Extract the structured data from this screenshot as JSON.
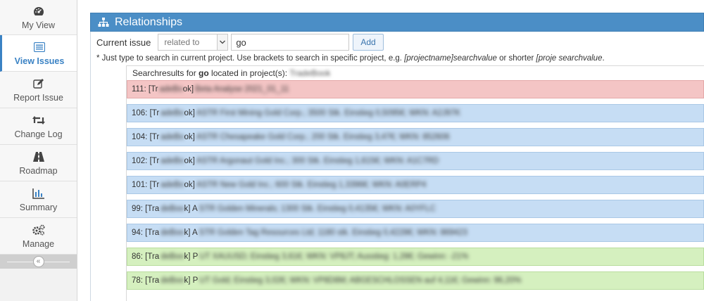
{
  "sidebar": {
    "items": [
      {
        "label": "My View",
        "icon": "dashboard-icon",
        "active": false
      },
      {
        "label": "View Issues",
        "icon": "list-icon",
        "active": true
      },
      {
        "label": "Report Issue",
        "icon": "edit-icon",
        "active": false
      },
      {
        "label": "Change Log",
        "icon": "retweet-icon",
        "active": false
      },
      {
        "label": "Roadmap",
        "icon": "road-icon",
        "active": false
      },
      {
        "label": "Summary",
        "icon": "bar-chart-icon",
        "active": false
      },
      {
        "label": "Manage",
        "icon": "gears-icon",
        "active": false
      }
    ],
    "collapse_glyph": "«"
  },
  "panel": {
    "title": "Relationships",
    "current_issue_label": "Current issue",
    "relation_select_value": "related to",
    "search_value": "go",
    "add_label": "Add",
    "hint_prefix": "* Just type to search in current project. Use brackets to search in specific project, e.g. ",
    "hint_example1": "[projectname]searchvalue",
    "hint_middle": " or shorter ",
    "hint_example2": "[proje searchvalue",
    "hint_suffix": "."
  },
  "results": {
    "head_prefix": "Searchresults for ",
    "query": "go",
    "head_suffix": " located in project(s): ",
    "project": "TradeBook",
    "rows": [
      {
        "id": "111",
        "prefix": "111: [Tr",
        "project_blur": "adeBo",
        "suffix": "ok]",
        "summary": "Beta Analyse 2021_01_11",
        "color": "red"
      },
      {
        "id": "106",
        "prefix": "106: [Tr",
        "project_blur": "adeBo",
        "suffix": "ok]",
        "summary": "ASTR First Mining Gold Corp.; 3500 Stk. Einstieg 0,5095€; WKN: A2J97K",
        "color": "blue"
      },
      {
        "id": "104",
        "prefix": "104: [Tr",
        "project_blur": "adeBo",
        "suffix": "ok]",
        "summary": "ASTR Chesapeake Gold Corp.; 200 Stk. Einstieg 3,47€; WKN: 852606",
        "color": "blue"
      },
      {
        "id": "102",
        "prefix": "102: [Tr",
        "project_blur": "adeBo",
        "suffix": "ok]",
        "summary": "ASTR Argonaut Gold Inc.; 300 Stk. Einstieg 1,615€; WKN: A1C7RD",
        "color": "blue"
      },
      {
        "id": "101",
        "prefix": "101: [Tr",
        "project_blur": "adeBo",
        "suffix": "ok]",
        "summary": "ASTR New Gold Inc.; 600 Stk. Einstieg 1,3396€; WKN: A0ERP4",
        "color": "blue"
      },
      {
        "id": "99",
        "prefix": "99: [Tra",
        "project_blur": "deBoo",
        "suffix": "k] A",
        "summary": "STR Golden Minerals; 1300 Stk. Einstieg 0,4135€; WKN: A0YFLC",
        "color": "blue"
      },
      {
        "id": "94",
        "prefix": "94: [Tra",
        "project_blur": "deBoo",
        "suffix": "k] A",
        "summary": "STR Golden Tag Resources Ltd; 1180 stk. Einstieg 0,4228€; WKN: 869423",
        "color": "blue"
      },
      {
        "id": "86",
        "prefix": "86: [Tra",
        "project_blur": "deBoo",
        "suffix": "k] P",
        "summary": "UT XAUUSD; Einstieg 3,61€; WKN: VP8JT; Ausstieg: 1,28€; Gewinn: -21%",
        "color": "green"
      },
      {
        "id": "78",
        "prefix": "78: [Tra",
        "project_blur": "deBoo",
        "suffix": "k] P",
        "summary": "UT Gold; Einstieg 3,02€; WKN: VP8D8M; ABGESCHLOSSEN auf 4,11€; Gewinn: 96,20%",
        "color": "green"
      }
    ]
  },
  "colors": {
    "accent": "#4b8ec6",
    "row_red": "#f4c5c5",
    "row_blue": "#c6ddf4",
    "row_green": "#d5f0bf"
  }
}
